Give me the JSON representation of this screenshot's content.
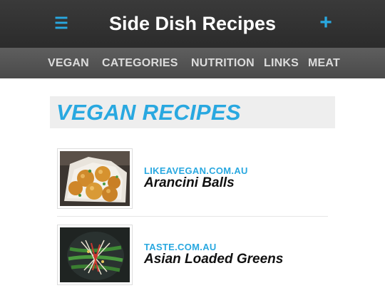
{
  "header": {
    "title": "Side Dish Recipes",
    "menu_icon": "hamburger-menu-icon",
    "add_icon": "plus-icon",
    "accent_color": "#29a8e0"
  },
  "nav": {
    "items": [
      {
        "label": "VEGAN"
      },
      {
        "label": "CATEGORIES"
      },
      {
        "label": "NUTRITION"
      },
      {
        "label": "LINKS"
      },
      {
        "label": "MEAT"
      }
    ]
  },
  "main": {
    "section_title": "VEGAN RECIPES",
    "recipes": [
      {
        "source": "LIKEAVEGAN.COM.AU",
        "name": "Arancini Balls"
      },
      {
        "source": "TASTE.COM.AU",
        "name": "Asian Loaded Greens"
      }
    ]
  }
}
